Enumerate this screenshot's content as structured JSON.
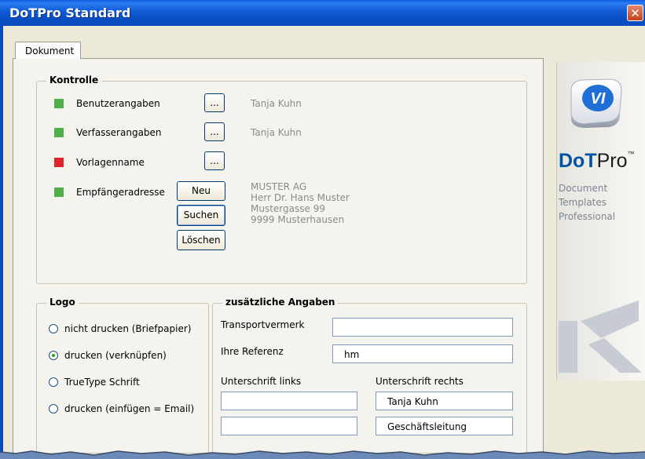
{
  "window": {
    "title": "DoTPro Standard",
    "close_glyph": "✕"
  },
  "tabs": [
    {
      "label": "Dokument",
      "active": true
    }
  ],
  "kontrolle": {
    "legend": "Kontrolle",
    "rows": [
      {
        "status": "green",
        "label": "Benutzerangaben",
        "button": "...",
        "value": "Tanja Kuhn"
      },
      {
        "status": "green",
        "label": "Verfasserangaben",
        "button": "...",
        "value": "Tanja Kuhn"
      },
      {
        "status": "red",
        "label": "Vorlagenname",
        "button": "..."
      },
      {
        "status": "green",
        "label": "Empfängeradresse"
      }
    ],
    "address_buttons": {
      "new": "Neu",
      "search": "Suchen",
      "delete": "Löschen"
    },
    "address_lines": [
      "MUSTER AG",
      "Herr Dr. Hans Muster",
      "Mustergasse 99",
      "9999 Musterhausen"
    ]
  },
  "logo": {
    "legend": "Logo",
    "options": [
      {
        "label": "nicht drucken (Briefpapier)",
        "selected": false
      },
      {
        "label": "drucken (verknüpfen)",
        "selected": true
      },
      {
        "label": "TrueType Schrift",
        "selected": false
      },
      {
        "label": "drucken (einfügen = Email)",
        "selected": false
      }
    ]
  },
  "zusatz": {
    "legend": "zusätzliche Angaben",
    "transportvermerk": {
      "label": "Transportvermerk",
      "value": ""
    },
    "referenz": {
      "label": "Ihre Referenz",
      "value": "hm"
    },
    "sig_left": {
      "label": "Unterschrift links",
      "line1": "",
      "line2": ""
    },
    "sig_right": {
      "label": "Unterschrift rechts",
      "line1": "Tanja Kuhn",
      "line2": "Geschäftsleitung"
    }
  },
  "brand": {
    "cube_text": "VI",
    "name_bold": "DoT",
    "name_rest": "Pro",
    "tm": "™",
    "tagline": [
      "Document",
      "Templates",
      "Professional"
    ]
  },
  "colors": {
    "status_green": "#4fb04b",
    "status_red": "#e0242b",
    "titlebar": "#0a4fc4"
  }
}
